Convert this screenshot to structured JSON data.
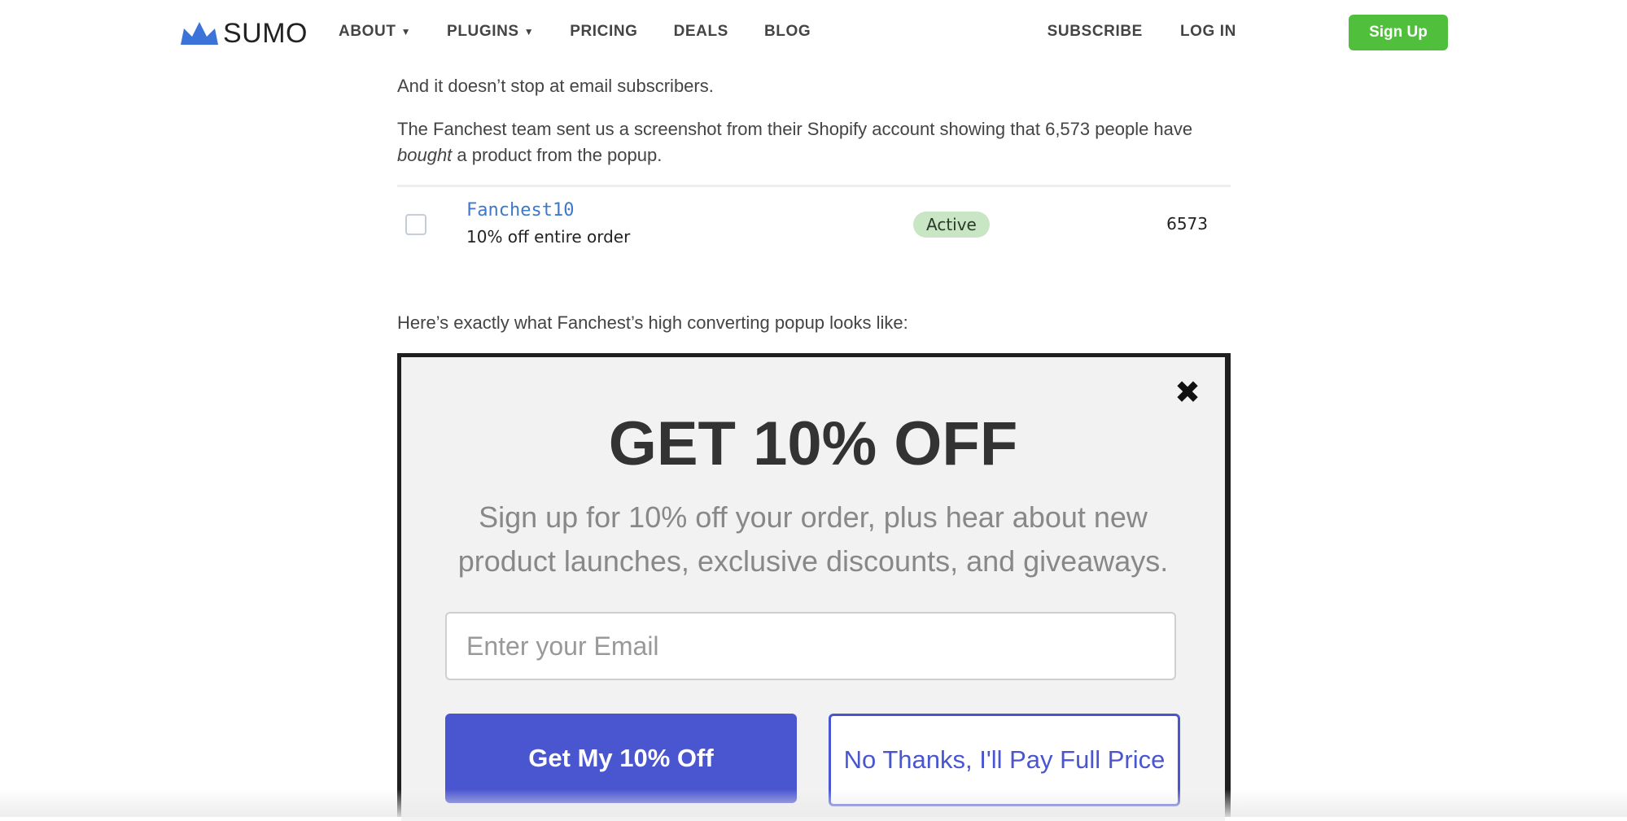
{
  "header": {
    "logo_text": "SUMO",
    "logo_color": "#3b73d9",
    "nav": [
      {
        "label": "ABOUT",
        "has_dropdown": true
      },
      {
        "label": "PLUGINS",
        "has_dropdown": true
      },
      {
        "label": "PRICING",
        "has_dropdown": false
      },
      {
        "label": "DEALS",
        "has_dropdown": false
      },
      {
        "label": "BLOG",
        "has_dropdown": false
      }
    ],
    "subscribe_label": "SUBSCRIBE",
    "login_label": "LOG IN",
    "signup_label": "Sign Up",
    "signup_color": "#4fbf3c"
  },
  "article": {
    "para1": "And it doesn’t stop at email subscribers.",
    "para2_start": "The Fanchest team sent us a screenshot from their Shopify account showing that 6,573 people have ",
    "para2_em": "bought",
    "para2_end": " a product from the popup.",
    "para3": "Here’s exactly what Fanchest’s high converting popup looks like:"
  },
  "discount_table": {
    "row": {
      "code": "Fanchest10",
      "description": "10% off entire order",
      "status": "Active",
      "uses": "6573"
    }
  },
  "popup": {
    "close_glyph": "✖",
    "title": "GET 10% OFF",
    "subtitle": "Sign up for 10% off your order, plus hear about new product launches, exclusive discounts, and giveaways.",
    "email_placeholder": "Enter your Email",
    "primary_button": "Get My 10% Off",
    "secondary_button": "No Thanks, I'll Pay Full Price",
    "accent_color": "#4a55d0"
  }
}
